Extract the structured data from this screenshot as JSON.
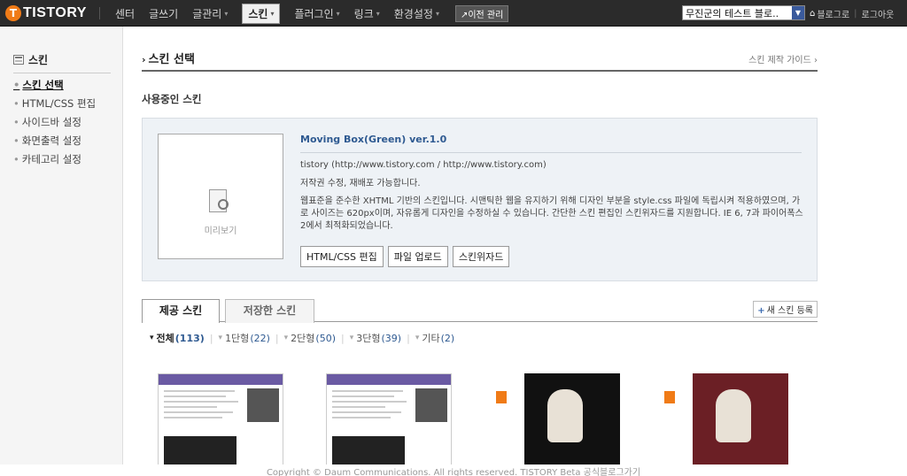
{
  "topbar": {
    "logo_letter": "T",
    "logo_text": "TISTORY",
    "nav": [
      {
        "label": "센터",
        "caret": false,
        "active": false
      },
      {
        "label": "글쓰기",
        "caret": false,
        "active": false
      },
      {
        "label": "글관리",
        "caret": true,
        "active": false
      },
      {
        "label": "스킨",
        "caret": true,
        "active": true
      },
      {
        "label": "플러그인",
        "caret": true,
        "active": false
      },
      {
        "label": "링크",
        "caret": true,
        "active": false
      },
      {
        "label": "환경설정",
        "caret": true,
        "active": false
      }
    ],
    "caret_glyph": "▾",
    "old_admin_label": "↗이전 관리",
    "blog_select_value": "무진군의 테스트 블로..",
    "blog_link": "블로그로",
    "logout": "로그아웃"
  },
  "sidebar": {
    "title": "스킨",
    "items": [
      "스킨 선택",
      "HTML/CSS 편집",
      "사이드바 설정",
      "화면출력 설정",
      "카테고리 설정"
    ],
    "current_index": 0
  },
  "main": {
    "page_title": "스킨 선택",
    "guide_link": "스킨 제작 가이드 ›",
    "section_title": "사용중인 스킨",
    "current_skin": {
      "preview_label": "미리보기",
      "name": "Moving Box(Green) ver.1.0",
      "author_line": "tistory   (http://www.tistory.com / http://www.tistory.com)",
      "rights_line": "저작권   수정, 재배포 가능합니다.",
      "description": "웹표준을 준수한 XHTML 기반의 스킨입니다. 시맨틱한 웹을 유지하기 위해 디자인 부분을 style.css 파일에 독립시켜 적용하였으며, 가로 사이즈는 620px이며, 자유롭게 디자인을 수정하실 수 있습니다. 간단한 스킨 편집인 스킨위자드를 지원합니다. IE 6, 7과 파이어폭스 2에서 최적화되었습니다.",
      "buttons": [
        "HTML/CSS 편집",
        "파일 업로드",
        "스킨위자드"
      ]
    },
    "tabs": [
      "제공 스킨",
      "저장한 스킨"
    ],
    "new_skin_button": "새 스킨 등록",
    "filters": [
      {
        "label": "전체",
        "count": "(113)"
      },
      {
        "label": "1단형",
        "count": "(22)"
      },
      {
        "label": "2단형",
        "count": "(50)"
      },
      {
        "label": "3단형",
        "count": "(39)"
      },
      {
        "label": "기타",
        "count": "(2)"
      }
    ]
  },
  "footer": "Copyright © Daum Communications. All rights reserved. TISTORY Beta 공식블로그가기"
}
